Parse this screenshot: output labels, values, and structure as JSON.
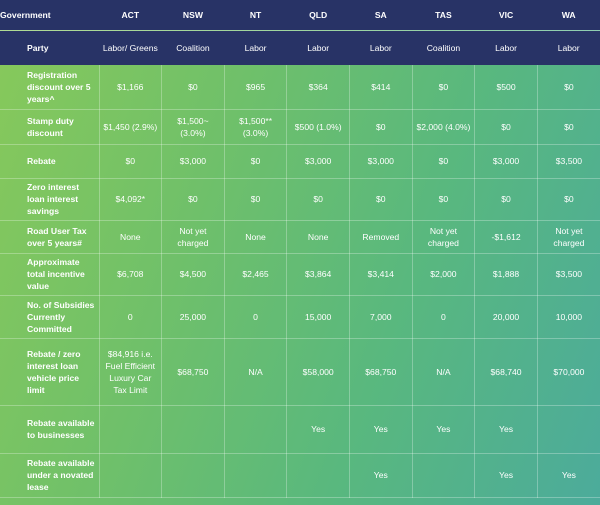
{
  "header": {
    "first_col": "Government",
    "states": [
      "ACT",
      "NSW",
      "NT",
      "QLD",
      "SA",
      "TAS",
      "VIC",
      "WA"
    ]
  },
  "party_row": {
    "label": "Party",
    "values": [
      "Labor/ Greens",
      "Coalition",
      "Labor",
      "Labor",
      "Labor",
      "Coalition",
      "Labor",
      "Labor"
    ]
  },
  "rows": [
    {
      "label": "Registration discount over 5 years^",
      "values": [
        "$1,166",
        "$0",
        "$965",
        "$364",
        "$414",
        "$0",
        "$500",
        "$0"
      ]
    },
    {
      "label": "Stamp duty discount",
      "values": [
        "$1,450 (2.9%)",
        "$1,500~ (3.0%)",
        "$1,500** (3.0%)",
        "$500 (1.0%)",
        "$0",
        "$2,000 (4.0%)",
        "$0",
        "$0"
      ]
    },
    {
      "label": "Rebate",
      "values": [
        "$0",
        "$3,000",
        "$0",
        "$3,000",
        "$3,000",
        "$0",
        "$3,000",
        "$3,500"
      ]
    },
    {
      "label": "Zero interest loan interest savings",
      "values": [
        "$4,092*",
        "$0",
        "$0",
        "$0",
        "$0",
        "$0",
        "$0",
        "$0"
      ]
    },
    {
      "label": "Road User Tax over 5 years#",
      "values": [
        "None",
        "Not yet charged",
        "None",
        "None",
        "Removed",
        "Not yet charged",
        "-$1,612",
        "Not yet charged"
      ]
    },
    {
      "label": "Approximate total incentive value",
      "values": [
        "$6,708",
        "$4,500",
        "$2,465",
        "$3,864",
        "$3,414",
        "$2,000",
        "$1,888",
        "$3,500"
      ]
    },
    {
      "label": "No. of Subsidies Currently Committed",
      "values": [
        "0",
        "25,000",
        "0",
        "15,000",
        "7,000",
        "0",
        "20,000",
        "10,000"
      ]
    },
    {
      "label": "Rebate / zero interest loan vehicle price limit",
      "values": [
        "$84,916 i.e. Fuel Efficient Luxury Car Tax Limit",
        "$68,750",
        "N/A",
        "$58,000",
        "$68,750",
        "N/A",
        "$68,740",
        "$70,000"
      ]
    },
    {
      "label": "Rebate available to businesses",
      "values": [
        "",
        "",
        "",
        "Yes",
        "Yes",
        "Yes",
        "Yes",
        ""
      ]
    },
    {
      "label": "Rebate available under a novated lease",
      "values": [
        "",
        "",
        "",
        "",
        "Yes",
        "",
        "Yes",
        "Yes"
      ]
    }
  ]
}
